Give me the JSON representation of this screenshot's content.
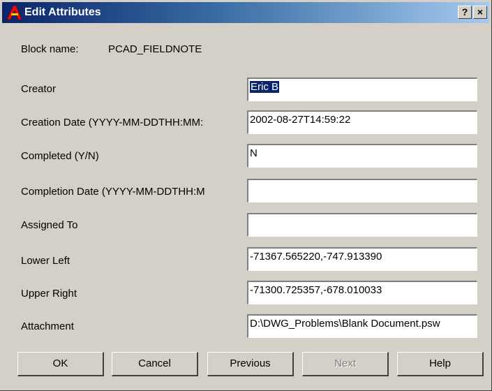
{
  "window": {
    "title": "Edit Attributes",
    "help_glyph": "?",
    "close_glyph": "×"
  },
  "block": {
    "label": "Block name:",
    "value": "PCAD_FIELDNOTE"
  },
  "attributes": [
    {
      "label": "Creator",
      "value": "Eric B"
    },
    {
      "label": "Creation Date (YYYY-MM-DDTHH:MM:",
      "value": "2002-08-27T14:59:22"
    },
    {
      "label": "Completed (Y/N)",
      "value": "N"
    },
    {
      "label": "Completion Date (YYYY-MM-DDTHH:M",
      "value": ""
    },
    {
      "label": "Assigned To",
      "value": ""
    },
    {
      "label": "Lower Left",
      "value": "-71367.565220,-747.913390"
    },
    {
      "label": "Upper Right",
      "value": "-71300.725357,-678.010033"
    },
    {
      "label": "Attachment",
      "value": "D:\\DWG_Problems\\Blank Document.psw"
    }
  ],
  "buttons": {
    "ok": "OK",
    "cancel": "Cancel",
    "previous": "Previous",
    "next": "Next",
    "help": "Help"
  }
}
